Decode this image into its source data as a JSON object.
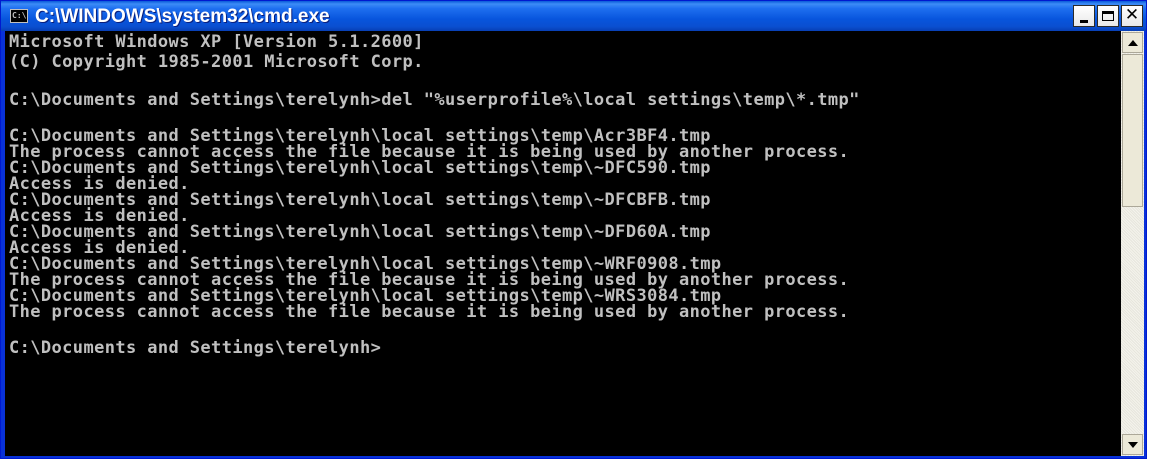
{
  "window": {
    "title": "C:\\WINDOWS\\system32\\cmd.exe",
    "icon_text": "C:\\"
  },
  "console": {
    "lines": [
      "Microsoft Windows XP [Version 5.1.2600]",
      "(C) Copyright 1985-2001 Microsoft Corp.",
      "",
      "C:\\Documents and Settings\\terelynh>del \"%userprofile%\\local settings\\temp\\*.tmp\"",
      "",
      "C:\\Documents and Settings\\terelynh\\local settings\\temp\\Acr3BF4.tmp",
      "The process cannot access the file because it is being used by another process.",
      "C:\\Documents and Settings\\terelynh\\local settings\\temp\\~DFC590.tmp",
      "Access is denied.",
      "C:\\Documents and Settings\\terelynh\\local settings\\temp\\~DFCBFB.tmp",
      "Access is denied.",
      "C:\\Documents and Settings\\terelynh\\local settings\\temp\\~DFD60A.tmp",
      "Access is denied.",
      "C:\\Documents and Settings\\terelynh\\local settings\\temp\\~WRF0908.tmp",
      "The process cannot access the file because it is being used by another process.",
      "C:\\Documents and Settings\\terelynh\\local settings\\temp\\~WRS3084.tmp",
      "The process cannot access the file because it is being used by another process.",
      "",
      "C:\\Documents and Settings\\terelynh>"
    ]
  },
  "colors": {
    "console_background": "#000000",
    "console_text": "#c0c0c0",
    "titlebar": "#0a4fd0",
    "close_button": "#ffffff"
  },
  "icons": [
    "cmd-app-icon",
    "minimize-icon",
    "maximize-icon",
    "close-icon",
    "scroll-up-arrow-icon",
    "scroll-down-arrow-icon"
  ]
}
